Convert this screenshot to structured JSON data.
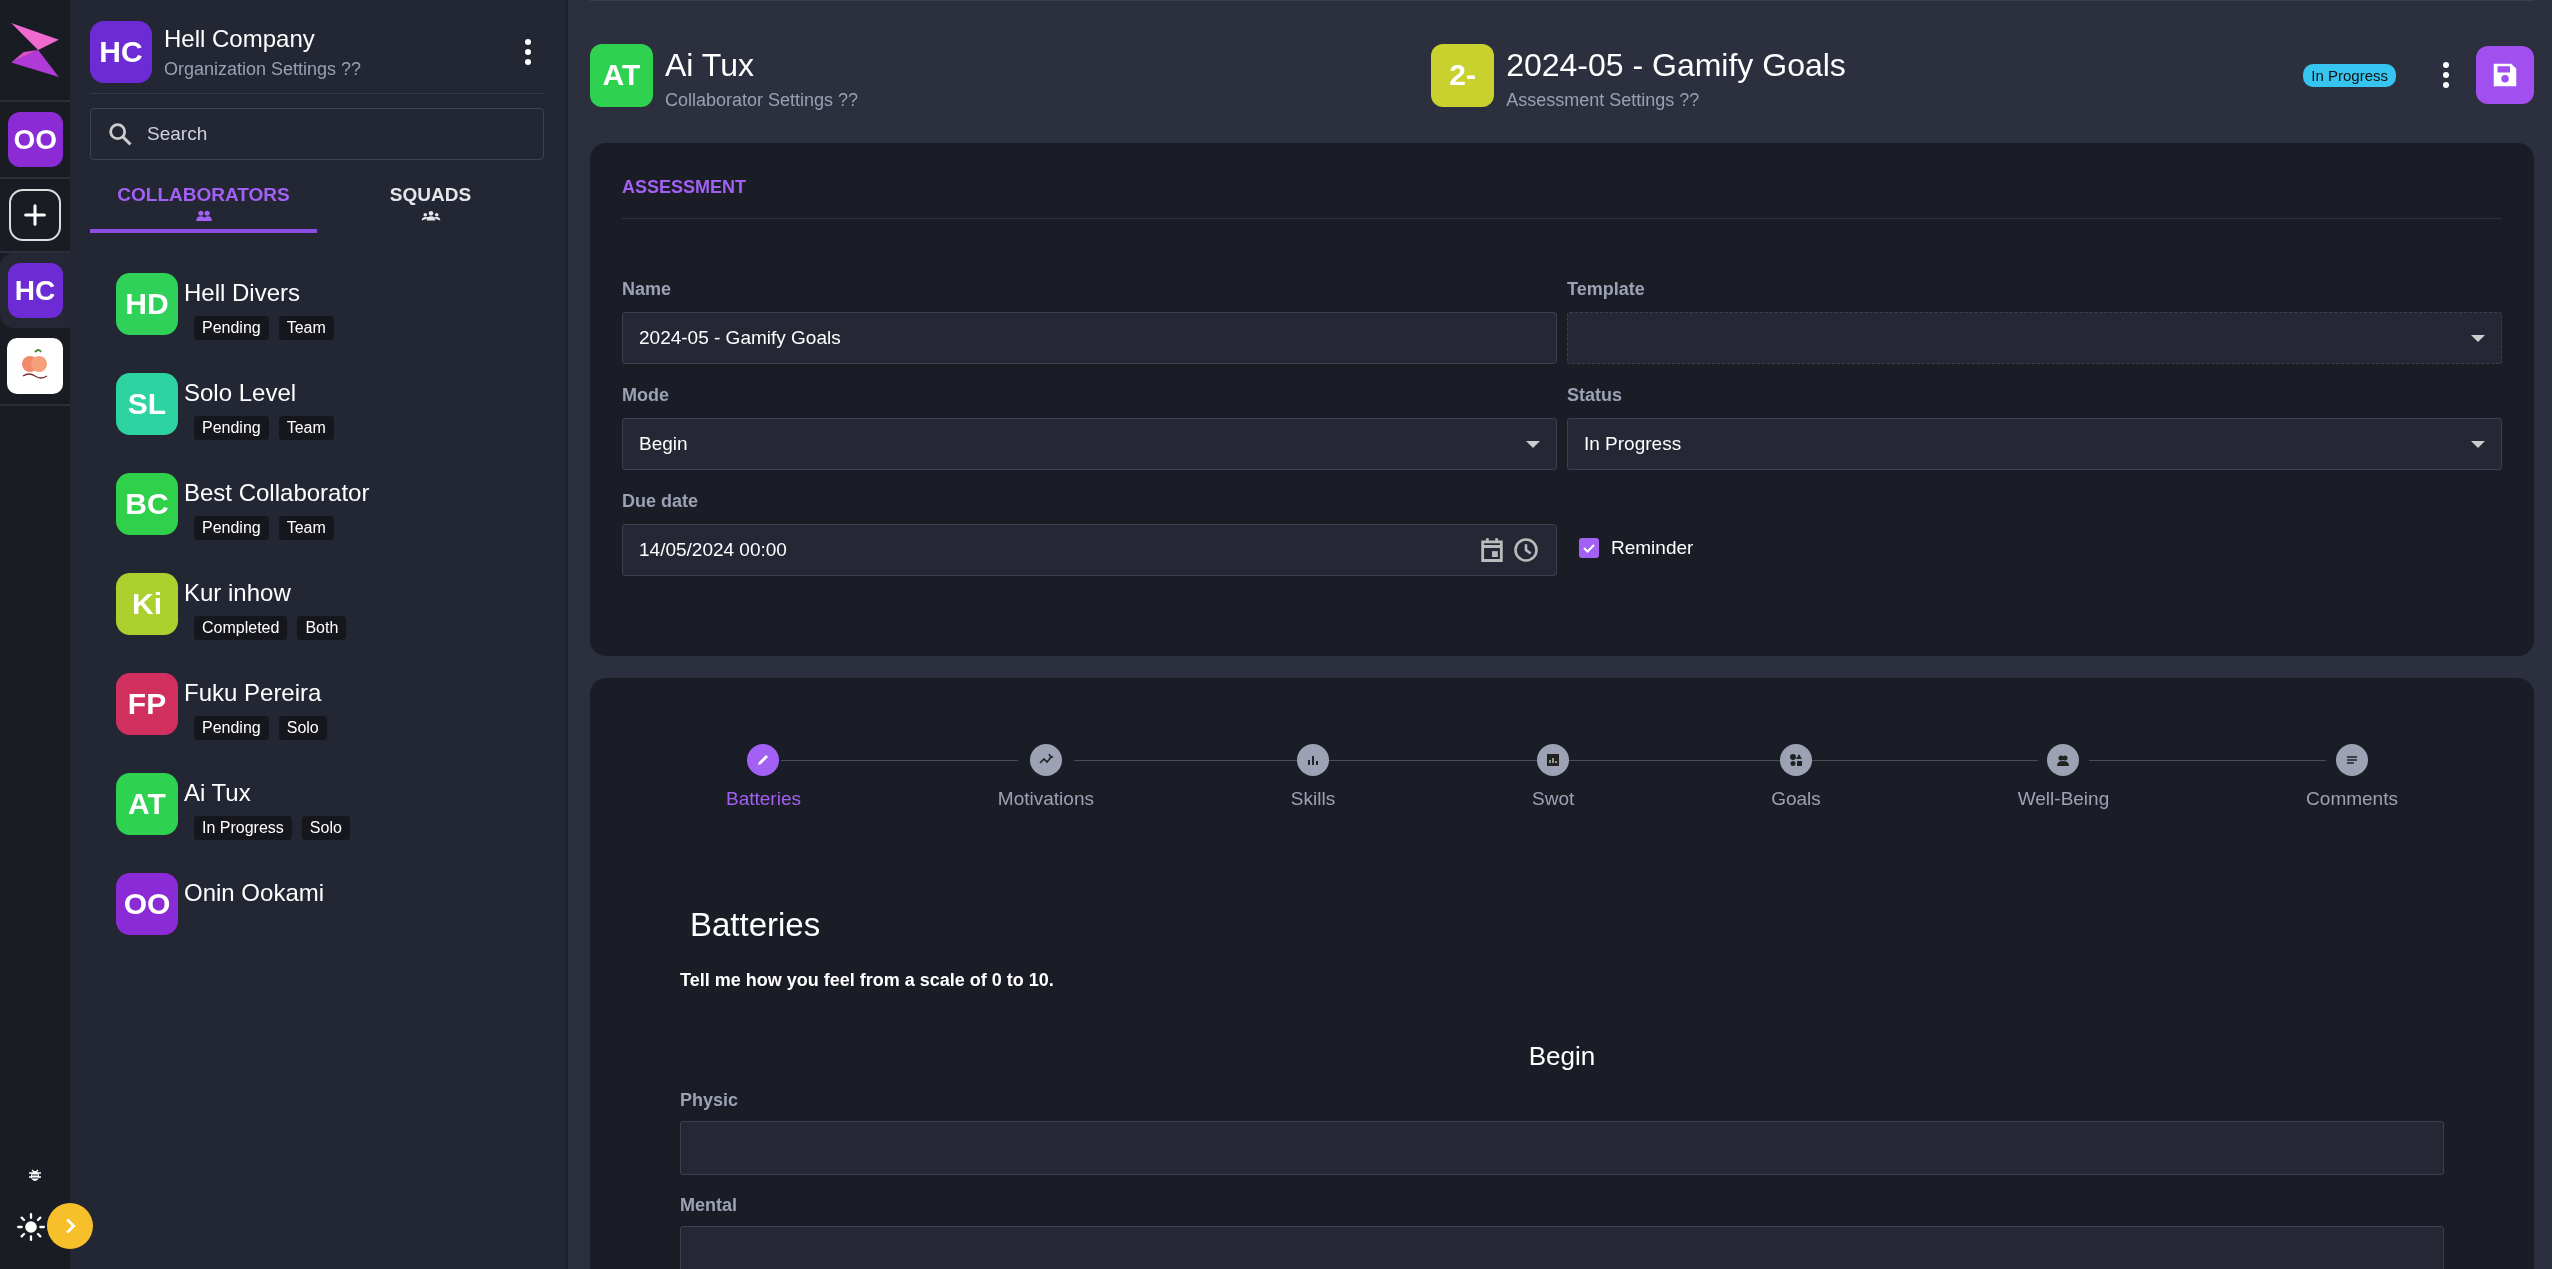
{
  "rail": {
    "items": [
      {
        "kind": "avatar",
        "initials": "OO",
        "color": "#8a2bd6",
        "selected": false
      },
      {
        "kind": "add"
      },
      {
        "kind": "avatar",
        "initials": "HC",
        "color": "#6d2bd6",
        "selected": true
      },
      {
        "kind": "logo",
        "selected": false
      }
    ]
  },
  "organization": {
    "initials": "HC",
    "name": "Hell Company",
    "subtitle": "Organization Settings ??"
  },
  "search": {
    "placeholder": "Search"
  },
  "tabs": [
    {
      "label": "COLLABORATORS",
      "kind": "people",
      "selected": true
    },
    {
      "label": "SQUADS",
      "kind": "group",
      "selected": false
    }
  ],
  "collaborators": [
    {
      "initials": "HD",
      "name": "Hell Divers",
      "color": "#2fd158",
      "tags": [
        "Pending",
        "Team"
      ]
    },
    {
      "initials": "SL",
      "name": "Solo Level",
      "color": "#2dd3a0",
      "tags": [
        "Pending",
        "Team"
      ]
    },
    {
      "initials": "BC",
      "name": "Best Collaborator",
      "color": "#2fd14a",
      "tags": [
        "Pending",
        "Team"
      ]
    },
    {
      "initials": "Ki",
      "name": "Kur inhow",
      "color": "#acd12f",
      "tags": [
        "Completed",
        "Both"
      ]
    },
    {
      "initials": "FP",
      "name": "Fuku Pereira",
      "color": "#d12f5e",
      "tags": [
        "Pending",
        "Solo"
      ]
    },
    {
      "initials": "AT",
      "name": "Ai Tux",
      "color": "#2fd150",
      "tags": [
        "In Progress",
        "Solo"
      ]
    },
    {
      "initials": "OO",
      "name": "Onin Ookami",
      "color": "#8a2bd6"
    }
  ],
  "header": {
    "collaborator": {
      "initials": "AT",
      "name": "Ai Tux",
      "subtitle": "Collaborator Settings ??"
    },
    "assessment": {
      "initials": "2-",
      "title": "2024-05 - Gamify Goals",
      "subtitle": "Assessment Settings ??"
    },
    "status": "In Progress"
  },
  "form": {
    "section": "ASSESSMENT",
    "fields": [
      {
        "label": "Name",
        "kind": "text",
        "value": "2024-05 - Gamify Goals"
      },
      {
        "label": "Template",
        "kind": "select",
        "dashed": true
      },
      {
        "label": "Mode",
        "kind": "select",
        "value": "Begin"
      },
      {
        "label": "Status",
        "kind": "select",
        "value": "In Progress"
      },
      {
        "label": "Due date",
        "kind": "date",
        "value": "14/05/2024 00:00"
      }
    ],
    "reminder": {
      "label": "Reminder",
      "checked": true
    }
  },
  "steps": [
    {
      "label": "Batteries",
      "kind": "pencil",
      "selected": true
    },
    {
      "label": "Motivations",
      "kind": "sparkle",
      "selected": false
    },
    {
      "label": "Skills",
      "kind": "bars",
      "selected": false
    },
    {
      "label": "Swot",
      "kind": "square",
      "selected": false
    },
    {
      "label": "Goals",
      "kind": "shapes",
      "selected": false
    },
    {
      "label": "Well-Being",
      "kind": "group",
      "selected": false
    },
    {
      "label": "Comments",
      "kind": "lines",
      "selected": false
    }
  ],
  "batteries": {
    "title": "Batteries",
    "description": "Tell me how you feel from a scale of 0 to 10.",
    "mode": "Begin",
    "inputs": [
      {
        "label": "Physic"
      },
      {
        "label": "Mental"
      }
    ]
  }
}
